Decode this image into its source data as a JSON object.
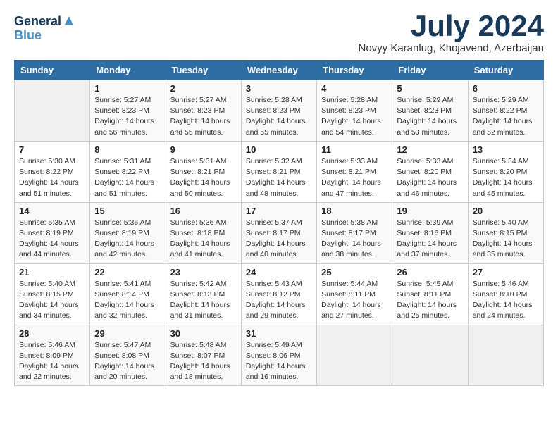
{
  "header": {
    "logo_line1": "General",
    "logo_line2": "Blue",
    "month": "July 2024",
    "location": "Novyy Karanlug, Khojavend, Azerbaijan"
  },
  "days_of_week": [
    "Sunday",
    "Monday",
    "Tuesday",
    "Wednesday",
    "Thursday",
    "Friday",
    "Saturday"
  ],
  "weeks": [
    [
      {
        "day": "",
        "info": ""
      },
      {
        "day": "1",
        "info": "Sunrise: 5:27 AM\nSunset: 8:23 PM\nDaylight: 14 hours\nand 56 minutes."
      },
      {
        "day": "2",
        "info": "Sunrise: 5:27 AM\nSunset: 8:23 PM\nDaylight: 14 hours\nand 55 minutes."
      },
      {
        "day": "3",
        "info": "Sunrise: 5:28 AM\nSunset: 8:23 PM\nDaylight: 14 hours\nand 55 minutes."
      },
      {
        "day": "4",
        "info": "Sunrise: 5:28 AM\nSunset: 8:23 PM\nDaylight: 14 hours\nand 54 minutes."
      },
      {
        "day": "5",
        "info": "Sunrise: 5:29 AM\nSunset: 8:23 PM\nDaylight: 14 hours\nand 53 minutes."
      },
      {
        "day": "6",
        "info": "Sunrise: 5:29 AM\nSunset: 8:22 PM\nDaylight: 14 hours\nand 52 minutes."
      }
    ],
    [
      {
        "day": "7",
        "info": "Sunrise: 5:30 AM\nSunset: 8:22 PM\nDaylight: 14 hours\nand 51 minutes."
      },
      {
        "day": "8",
        "info": "Sunrise: 5:31 AM\nSunset: 8:22 PM\nDaylight: 14 hours\nand 51 minutes."
      },
      {
        "day": "9",
        "info": "Sunrise: 5:31 AM\nSunset: 8:21 PM\nDaylight: 14 hours\nand 50 minutes."
      },
      {
        "day": "10",
        "info": "Sunrise: 5:32 AM\nSunset: 8:21 PM\nDaylight: 14 hours\nand 48 minutes."
      },
      {
        "day": "11",
        "info": "Sunrise: 5:33 AM\nSunset: 8:21 PM\nDaylight: 14 hours\nand 47 minutes."
      },
      {
        "day": "12",
        "info": "Sunrise: 5:33 AM\nSunset: 8:20 PM\nDaylight: 14 hours\nand 46 minutes."
      },
      {
        "day": "13",
        "info": "Sunrise: 5:34 AM\nSunset: 8:20 PM\nDaylight: 14 hours\nand 45 minutes."
      }
    ],
    [
      {
        "day": "14",
        "info": "Sunrise: 5:35 AM\nSunset: 8:19 PM\nDaylight: 14 hours\nand 44 minutes."
      },
      {
        "day": "15",
        "info": "Sunrise: 5:36 AM\nSunset: 8:19 PM\nDaylight: 14 hours\nand 42 minutes."
      },
      {
        "day": "16",
        "info": "Sunrise: 5:36 AM\nSunset: 8:18 PM\nDaylight: 14 hours\nand 41 minutes."
      },
      {
        "day": "17",
        "info": "Sunrise: 5:37 AM\nSunset: 8:17 PM\nDaylight: 14 hours\nand 40 minutes."
      },
      {
        "day": "18",
        "info": "Sunrise: 5:38 AM\nSunset: 8:17 PM\nDaylight: 14 hours\nand 38 minutes."
      },
      {
        "day": "19",
        "info": "Sunrise: 5:39 AM\nSunset: 8:16 PM\nDaylight: 14 hours\nand 37 minutes."
      },
      {
        "day": "20",
        "info": "Sunrise: 5:40 AM\nSunset: 8:15 PM\nDaylight: 14 hours\nand 35 minutes."
      }
    ],
    [
      {
        "day": "21",
        "info": "Sunrise: 5:40 AM\nSunset: 8:15 PM\nDaylight: 14 hours\nand 34 minutes."
      },
      {
        "day": "22",
        "info": "Sunrise: 5:41 AM\nSunset: 8:14 PM\nDaylight: 14 hours\nand 32 minutes."
      },
      {
        "day": "23",
        "info": "Sunrise: 5:42 AM\nSunset: 8:13 PM\nDaylight: 14 hours\nand 31 minutes."
      },
      {
        "day": "24",
        "info": "Sunrise: 5:43 AM\nSunset: 8:12 PM\nDaylight: 14 hours\nand 29 minutes."
      },
      {
        "day": "25",
        "info": "Sunrise: 5:44 AM\nSunset: 8:11 PM\nDaylight: 14 hours\nand 27 minutes."
      },
      {
        "day": "26",
        "info": "Sunrise: 5:45 AM\nSunset: 8:11 PM\nDaylight: 14 hours\nand 25 minutes."
      },
      {
        "day": "27",
        "info": "Sunrise: 5:46 AM\nSunset: 8:10 PM\nDaylight: 14 hours\nand 24 minutes."
      }
    ],
    [
      {
        "day": "28",
        "info": "Sunrise: 5:46 AM\nSunset: 8:09 PM\nDaylight: 14 hours\nand 22 minutes."
      },
      {
        "day": "29",
        "info": "Sunrise: 5:47 AM\nSunset: 8:08 PM\nDaylight: 14 hours\nand 20 minutes."
      },
      {
        "day": "30",
        "info": "Sunrise: 5:48 AM\nSunset: 8:07 PM\nDaylight: 14 hours\nand 18 minutes."
      },
      {
        "day": "31",
        "info": "Sunrise: 5:49 AM\nSunset: 8:06 PM\nDaylight: 14 hours\nand 16 minutes."
      },
      {
        "day": "",
        "info": ""
      },
      {
        "day": "",
        "info": ""
      },
      {
        "day": "",
        "info": ""
      }
    ]
  ]
}
